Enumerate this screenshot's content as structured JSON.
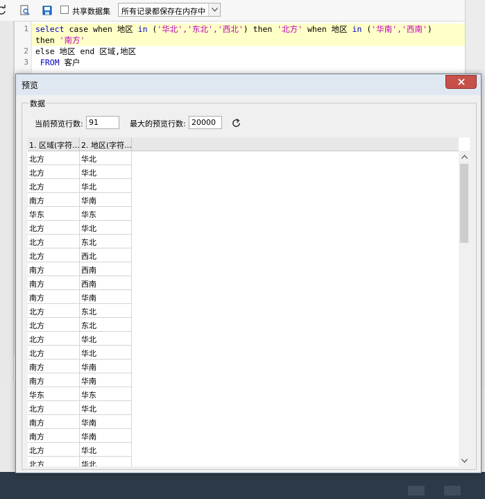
{
  "toolbar": {
    "share_dataset_label": "共享数据集",
    "storage_mode": "所有记录都保存在内存中"
  },
  "editor": {
    "line_numbers": [
      "1",
      "2",
      "3"
    ],
    "line1": {
      "kw_select": "select",
      "t1": " case when 地区 ",
      "kw_in1": "in",
      "t2": " (",
      "s1": "'华北','东北','西北'",
      "t3": ") then ",
      "s2": "'北方'",
      "t4": " when 地区 ",
      "kw_in2": "in",
      "t5": " (",
      "s3": "'华南','西南'",
      "t6": ")"
    },
    "line1_wrap": {
      "t1": "then ",
      "s1": "'南方'"
    },
    "line2": "else 地区 end 区域,地区",
    "line3": {
      "kw_from": " FROM",
      "t1": " 客户"
    }
  },
  "dialog": {
    "title": "预览",
    "group_label": "数据",
    "current_rows_label": "当前预览行数:",
    "current_rows_value": "91",
    "max_rows_label": "最大的预览行数:",
    "max_rows_value": "20000"
  },
  "grid": {
    "columns": [
      "1. 区域(字符...",
      "2. 地区(字符..."
    ],
    "rows": [
      [
        "北方",
        "华北"
      ],
      [
        "北方",
        "华北"
      ],
      [
        "北方",
        "华北"
      ],
      [
        "南方",
        "华南"
      ],
      [
        "华东",
        "华东"
      ],
      [
        "北方",
        "华北"
      ],
      [
        "北方",
        "东北"
      ],
      [
        "北方",
        "西北"
      ],
      [
        "南方",
        "西南"
      ],
      [
        "南方",
        "西南"
      ],
      [
        "南方",
        "华南"
      ],
      [
        "北方",
        "东北"
      ],
      [
        "北方",
        "东北"
      ],
      [
        "北方",
        "华北"
      ],
      [
        "北方",
        "华北"
      ],
      [
        "南方",
        "华南"
      ],
      [
        "南方",
        "华南"
      ],
      [
        "华东",
        "华东"
      ],
      [
        "北方",
        "华北"
      ],
      [
        "南方",
        "华南"
      ],
      [
        "南方",
        "华南"
      ],
      [
        "北方",
        "华北"
      ],
      [
        "北方",
        "华北"
      ]
    ]
  }
}
